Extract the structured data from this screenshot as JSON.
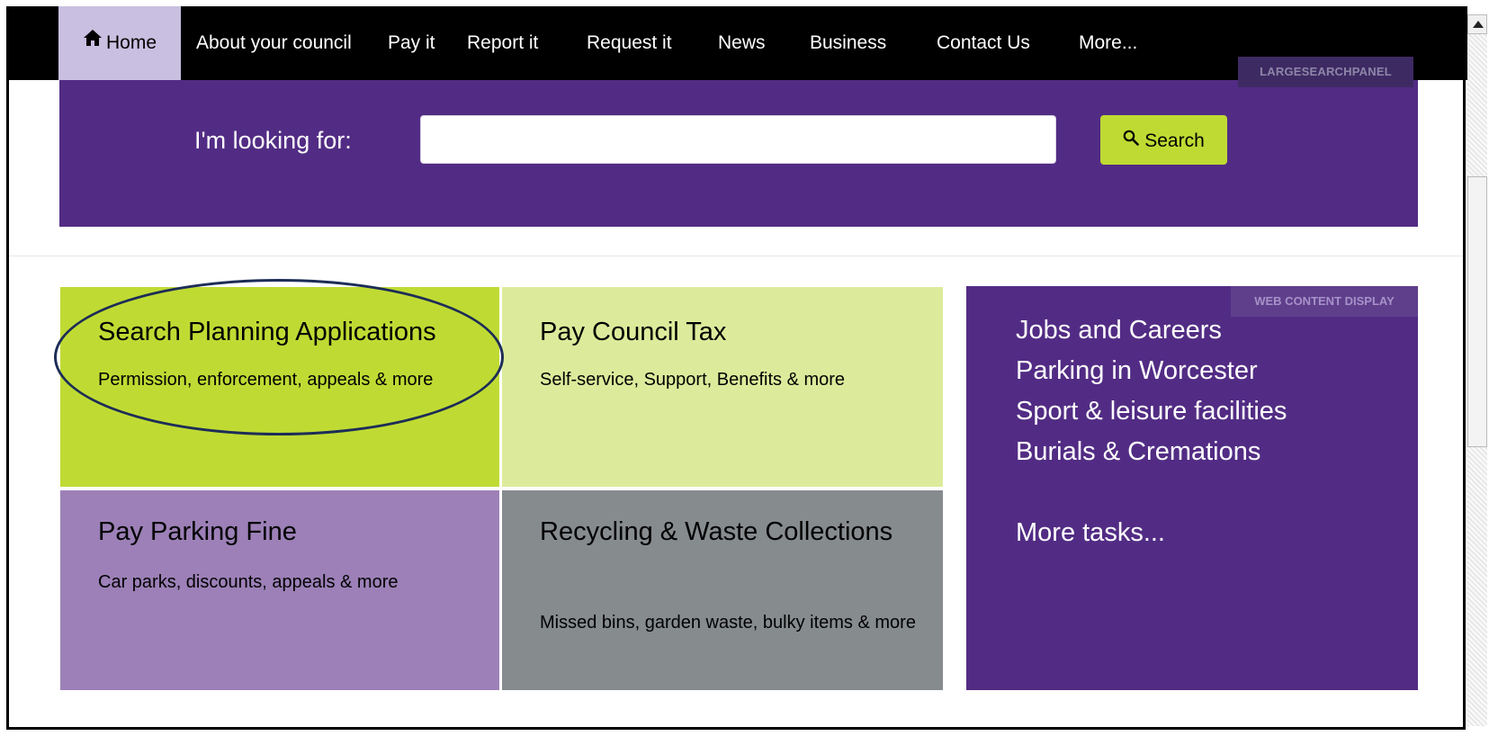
{
  "nav": {
    "items": [
      {
        "label": "Home",
        "icon": "home-icon"
      },
      {
        "label": "About your council"
      },
      {
        "label": "Pay it"
      },
      {
        "label": "Report it"
      },
      {
        "label": "Request it"
      },
      {
        "label": "News"
      },
      {
        "label": "Business"
      },
      {
        "label": "Contact Us"
      },
      {
        "label": "More..."
      }
    ],
    "active": "Home",
    "portlet_tag": "LARGESEARCHPANEL"
  },
  "search": {
    "label": "I'm looking for:",
    "value": "",
    "button_label": "Search",
    "button_icon": "search-icon"
  },
  "tiles": [
    {
      "title": "Search Planning Applications",
      "description": "Permission, enforcement, appeals & more",
      "highlighted": true
    },
    {
      "title": "Pay Council Tax",
      "description": "Self-service, Support, Benefits & more"
    },
    {
      "title": "Pay Parking Fine",
      "description": "Car parks, discounts, appeals & more"
    },
    {
      "title": "Recycling & Waste Collections",
      "description": "Missed bins, garden waste, bulky items & more"
    }
  ],
  "task_panel": {
    "tag": "WEB CONTENT DISPLAY",
    "links": [
      "Jobs and Careers",
      "Parking in Worcester",
      "Sport & leisure facilities",
      "Burials & Cremations"
    ],
    "more_link": "More tasks..."
  },
  "colors": {
    "nav_bg": "#000000",
    "nav_active_bg": "#c9bfe0",
    "purple": "#522c84",
    "lime": "#bfdb33",
    "light_lime": "#dceb9b",
    "lavender": "#9c80b7",
    "grey": "#868b8e",
    "highlight_ring": "#1d2d57"
  }
}
